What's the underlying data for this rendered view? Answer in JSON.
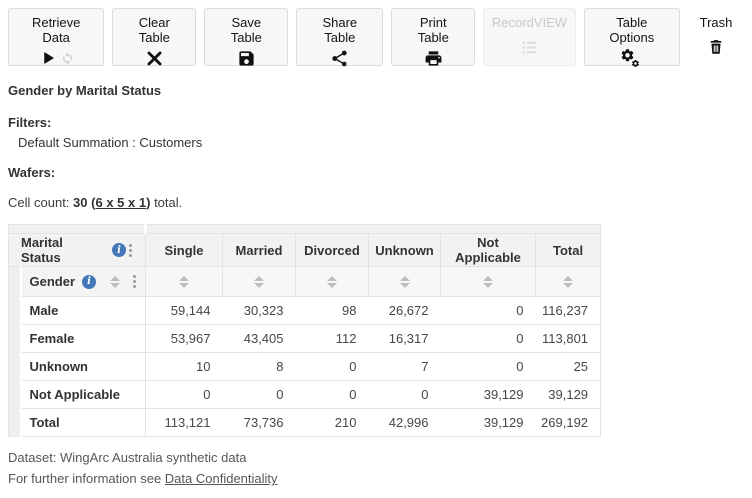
{
  "colors": {
    "accent_blue": "#4478b8",
    "header_bg": "#f2f2f2",
    "subheader_bg": "#f7f7f7",
    "strip_bg": "#efefef",
    "border": "#e3e3e3",
    "disabled_text": "#c9c9c9"
  },
  "toolbar": {
    "buttons": [
      {
        "label": "Retrieve Data",
        "icon": "play-icon + sync-icon",
        "enabled": true
      },
      {
        "label": "Clear Table",
        "icon": "clear-x-icon",
        "enabled": true
      },
      {
        "label": "Save Table",
        "icon": "floppy-save-icon",
        "enabled": true
      },
      {
        "label": "Share Table",
        "icon": "share-icon",
        "enabled": true
      },
      {
        "label": "Print Table",
        "icon": "printer-icon",
        "enabled": true
      },
      {
        "label": "RecordVIEW",
        "icon": "record-list-icon",
        "enabled": false
      },
      {
        "label": "Table Options",
        "icon": "gears-icon",
        "enabled": true
      },
      {
        "label": "Trash",
        "icon": "trash-icon",
        "enabled": true
      }
    ]
  },
  "headings": {
    "title": "Gender by Marital Status"
  },
  "filters": {
    "label": "Filters:",
    "value": "Default Summation : Customers"
  },
  "wafers": {
    "label": "Wafers:"
  },
  "cell_count": {
    "prefix": "Cell count:",
    "count": "30",
    "open_paren": "(",
    "link": "6 x 5 x 1",
    "close_paren": ")",
    "suffix": "total."
  },
  "table": {
    "corner_label": "Marital Status",
    "row_dimension_label": "Gender",
    "columns": [
      "Single",
      "Married",
      "Divorced",
      "Unknown",
      "Not Applicable",
      "Total"
    ],
    "rows": [
      {
        "label": "Male",
        "values": [
          "59,144",
          "30,323",
          "98",
          "26,672",
          "0",
          "116,237"
        ]
      },
      {
        "label": "Female",
        "values": [
          "53,967",
          "43,405",
          "112",
          "16,317",
          "0",
          "113,801"
        ]
      },
      {
        "label": "Unknown",
        "values": [
          "10",
          "8",
          "0",
          "7",
          "0",
          "25"
        ]
      },
      {
        "label": "Not Applicable",
        "values": [
          "0",
          "0",
          "0",
          "0",
          "39,129",
          "39,129"
        ]
      },
      {
        "label": "Total",
        "values": [
          "113,121",
          "73,736",
          "210",
          "42,996",
          "39,129",
          "269,192"
        ],
        "is_total": true
      }
    ]
  },
  "footer": {
    "dataset_line": "Dataset: WingArc Australia synthetic data",
    "info_prefix": "For further information see ",
    "link": "Data Confidentiality"
  }
}
